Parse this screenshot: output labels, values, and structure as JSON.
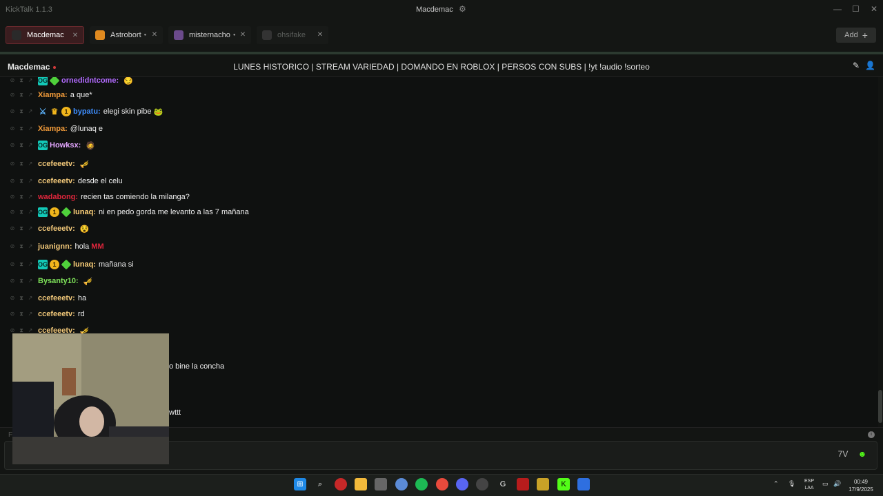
{
  "window": {
    "app_title": "KickTalk 1.1.3",
    "center_title": "Macdemac",
    "gear_icon": "gear-icon",
    "minimize": "—",
    "maximize": "☐",
    "close": "✕"
  },
  "tabs": [
    {
      "label": "Macdemac",
      "close": "✕",
      "state": "active",
      "color": "#3a1d1f"
    },
    {
      "label": "Astrobort",
      "close": "✕",
      "state": "inactive",
      "live": "●"
    },
    {
      "label": "misternacho",
      "close": "✕",
      "state": "inactive",
      "live": "●"
    },
    {
      "label": "ohsifake",
      "close": "✕",
      "state": "offline"
    }
  ],
  "add_button": {
    "label": "Add",
    "icon": "+"
  },
  "channel": {
    "name": "Macdemac",
    "stream_title": "LUNES HISTORICO | STREAM VARIEDAD | DOMANDO EN ROBLOX | PERSOS CON SUBS | !yt !audio !sorteo"
  },
  "messages": [
    {
      "user": "ornedidntcome:",
      "text": "",
      "color": "#b26bff",
      "badges": [
        "og",
        "gift"
      ],
      "emote": "😏"
    },
    {
      "user": "Xiampa:",
      "text": "a que*",
      "color": "#f39c3a",
      "badges": []
    },
    {
      "user": "bypatu:",
      "text": "elegi skin pibe",
      "color": "#3f8fff",
      "badges": [
        "sword",
        "crown",
        "sub"
      ],
      "emote": "🐸"
    },
    {
      "user": "Xiampa:",
      "text": "@lunaq e",
      "color": "#f39c3a",
      "badges": []
    },
    {
      "user": "Howksx:",
      "text": "",
      "color": "#e3a6ff",
      "badges": [
        "og"
      ],
      "emote": "🧔"
    },
    {
      "user": "ccefeeetv:",
      "text": "",
      "color": "#f3c97a",
      "badges": [],
      "emote": "🎺"
    },
    {
      "user": "ccefeeetv:",
      "text": "desde el celu",
      "color": "#f3c97a",
      "badges": []
    },
    {
      "user": "wadabong:",
      "text": "recien tas comiendo la milanga?",
      "color": "#e0263c",
      "badges": []
    },
    {
      "user": "lunaq:",
      "text": "ni en pedo gorda me levanto a las 7 mañana",
      "color": "#ffd27a",
      "badges": [
        "og",
        "sub",
        "gift"
      ]
    },
    {
      "user": "ccefeeetv:",
      "text": "",
      "color": "#f3c97a",
      "badges": [],
      "emote": "😵"
    },
    {
      "user": "juanignn:",
      "text": "hola",
      "color": "#f3c97a",
      "badges": [],
      "emote": "MM"
    },
    {
      "user": "lunaq:",
      "text": "mañana si",
      "color": "#ffd27a",
      "badges": [
        "og",
        "sub",
        "gift"
      ]
    },
    {
      "user": "Bysanty10:",
      "text": "",
      "color": "#7fe35a",
      "badges": [],
      "emote": "🎺"
    },
    {
      "user": "ccefeeetv:",
      "text": "ha",
      "color": "#f3c97a",
      "badges": []
    },
    {
      "user": "ccefeeetv:",
      "text": "rd",
      "color": "#f3c97a",
      "badges": []
    },
    {
      "user": "ccefeeetv:",
      "text": "",
      "color": "#f3c97a",
      "badges": [],
      "emote": "🎺"
    }
  ],
  "partial_messages": [
    {
      "text": "o bine la concha"
    },
    {
      "text": "wttt"
    }
  ],
  "input": {
    "placeholder": "F",
    "info": "i",
    "emote_icon": "7tv-icon",
    "kick_icon": "kick-emote-icon"
  },
  "header_icons": {
    "pop": "✎",
    "user": "👤"
  },
  "taskbar": {
    "icons": [
      "windows-start-icon",
      "search-icon",
      "app-icon",
      "folder-icon",
      "app-icon",
      "browser-icon",
      "spotify-icon",
      "chrome-icon",
      "discord-icon",
      "app-icon",
      "app-icon",
      "app-icon",
      "app-icon",
      "kick-icon",
      "app-icon"
    ],
    "lang_top": "ESP",
    "lang_bottom": "LAA",
    "time": "00:49",
    "date": "17/9/2025"
  }
}
